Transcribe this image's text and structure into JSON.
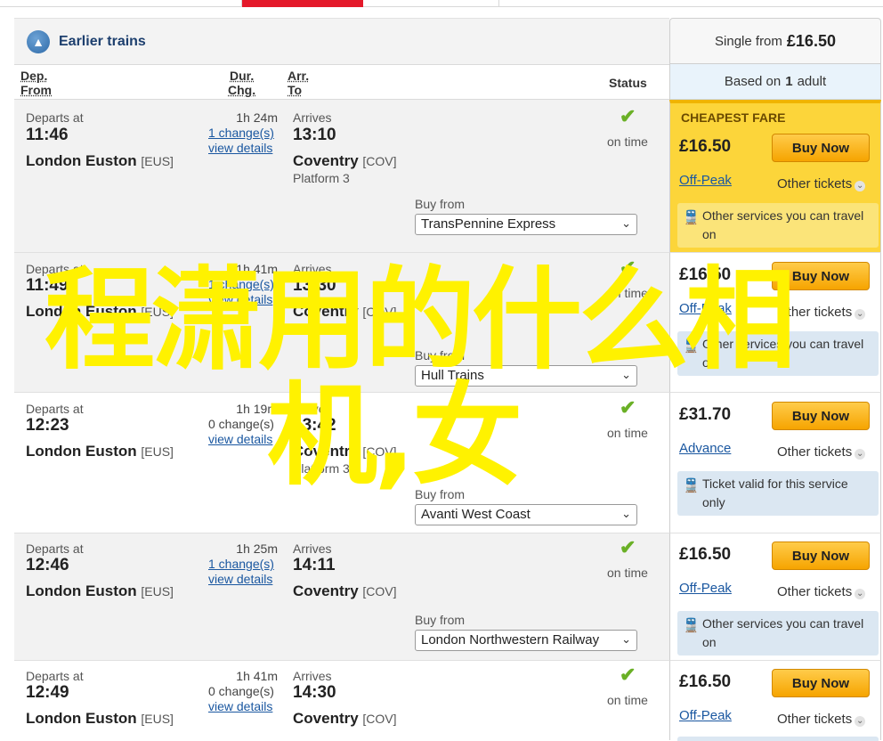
{
  "nav": {
    "earlier_trains": "Earlier trains",
    "single_from_label": "Single from",
    "single_from_price": "£16.50",
    "based_on_prefix": "Based on",
    "based_on_count": "1",
    "based_on_suffix": "adult"
  },
  "columns": {
    "dep": "Dep.",
    "from": "From",
    "dur": "Dur.",
    "chg": "Chg.",
    "arr": "Arr.",
    "to": "To",
    "status": "Status"
  },
  "journeys": [
    {
      "departs_label": "Departs at",
      "dep_time": "11:46",
      "from_station": "London Euston",
      "from_code": "[EUS]",
      "duration": "1h 24m",
      "changes": "1 change(s)",
      "view_details": "view details",
      "arrives_label": "Arrives",
      "arr_time": "13:10",
      "to_station": "Coventry",
      "to_code": "[COV]",
      "platform": "Platform 3",
      "status_icon": "check-icon",
      "status_text": "on time",
      "buy_from_label": "Buy from",
      "operator": "TransPennine Express",
      "cheapest_label": "CHEAPEST FARE",
      "price": "£16.50",
      "buy_label": "Buy Now",
      "fare_type": "Off-Peak",
      "other_tickets": "Other tickets",
      "note": "Other services you can travel on"
    },
    {
      "departs_label": "Departs at",
      "dep_time": "11:49",
      "from_station": "London Euston",
      "from_code": "[EUS]",
      "duration": "1h 41m",
      "changes": "1 change(s)",
      "view_details": "view details",
      "arrives_label": "Arrives",
      "arr_time": "13:30",
      "to_station": "Coventry",
      "to_code": "[COV]",
      "platform": "Platform 3",
      "status_icon": "check-icon",
      "status_text": "on time",
      "buy_from_label": "Buy from",
      "operator": "Hull Trains",
      "price": "£16.50",
      "buy_label": "Buy Now",
      "fare_type": "Off-Peak",
      "other_tickets": "Other tickets",
      "note": "Other services you can travel on"
    },
    {
      "departs_label": "Departs at",
      "dep_time": "12:23",
      "from_station": "London Euston",
      "from_code": "[EUS]",
      "duration": "1h 19m",
      "changes": "0 change(s)",
      "view_details": "view details",
      "arrives_label": "Arrives",
      "arr_time": "13:42",
      "to_station": "Coventry",
      "to_code": "[COV]",
      "platform": "Platform 3",
      "status_icon": "check-icon",
      "status_text": "on time",
      "buy_from_label": "Buy from",
      "operator": "Avanti West Coast",
      "price": "£31.70",
      "buy_label": "Buy Now",
      "fare_type": "Advance",
      "other_tickets": "Other tickets",
      "note": "Ticket valid for this service only"
    },
    {
      "departs_label": "Departs at",
      "dep_time": "12:46",
      "from_station": "London Euston",
      "from_code": "[EUS]",
      "duration": "1h 25m",
      "changes": "1 change(s)",
      "view_details": "view details",
      "arrives_label": "Arrives",
      "arr_time": "14:11",
      "to_station": "Coventry",
      "to_code": "[COV]",
      "status_icon": "check-icon",
      "status_text": "on time",
      "buy_from_label": "Buy from",
      "operator": "London Northwestern Railway",
      "price": "£16.50",
      "buy_label": "Buy Now",
      "fare_type": "Off-Peak",
      "other_tickets": "Other tickets",
      "note": "Other services you can travel on"
    },
    {
      "departs_label": "Departs at",
      "dep_time": "12:49",
      "from_station": "London Euston",
      "from_code": "[EUS]",
      "duration": "1h 41m",
      "changes": "0 change(s)",
      "view_details": "view details",
      "arrives_label": "Arrives",
      "arr_time": "14:30",
      "to_station": "Coventry",
      "to_code": "[COV]",
      "status_icon": "check-icon",
      "status_text": "on time",
      "price": "£16.50",
      "buy_label": "Buy Now",
      "fare_type": "Off-Peak",
      "other_tickets": "Other tickets"
    }
  ],
  "overlay": {
    "line1": "程潇用的什么相",
    "line2": "机,女"
  },
  "colors": {
    "accent_red": "#e4192a",
    "cheapest_yellow": "#fcd53a",
    "buy_orange": "#f6a400",
    "link_blue": "#1a57a0",
    "on_time_green": "#6ab026",
    "overlay_yellow": "#fff200"
  }
}
